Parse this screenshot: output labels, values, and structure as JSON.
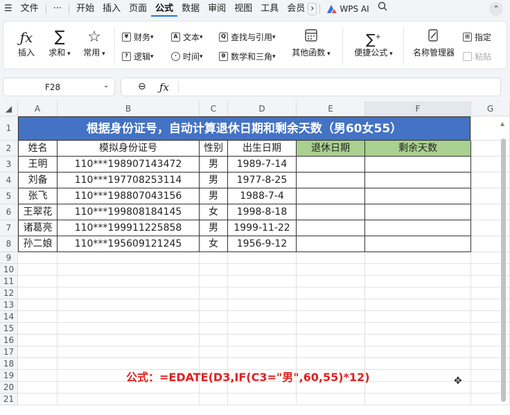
{
  "menu": {
    "items": [
      "文件",
      "开始",
      "插入",
      "页面",
      "公式",
      "数据",
      "审阅",
      "视图",
      "工具",
      "会员"
    ],
    "active": "公式",
    "wps_ai": "WPS AI"
  },
  "ribbon": {
    "insert": "插入",
    "sum": "求和",
    "common": "常用",
    "finance": "财务",
    "text": "文本",
    "lookup": "查找与引用",
    "logic": "逻辑",
    "time": "时间",
    "math": "数学和三角",
    "other": "其他函数",
    "quick": "便捷公式",
    "names": "名称管理器",
    "assign": "指定",
    "paste": "粘贴"
  },
  "namebox": "F28",
  "fx": "fx",
  "columns": [
    "A",
    "B",
    "C",
    "D",
    "E",
    "F",
    "G"
  ],
  "rows": [
    "1",
    "2",
    "3",
    "4",
    "5",
    "6",
    "7",
    "8",
    "9",
    "10",
    "11",
    "12",
    "13",
    "14",
    "15",
    "16",
    "17",
    "18",
    "19",
    "20",
    "21"
  ],
  "title": "根据身份证号，自动计算退休日期和剩余天数（男60女55）",
  "headers": [
    "姓名",
    "模拟身份证号",
    "性别",
    "出生日期",
    "退休日期",
    "剩余天数"
  ],
  "table": [
    [
      "王明",
      "110***198907143472",
      "男",
      "1989-7-14",
      "",
      ""
    ],
    [
      "刘备",
      "110***197708253114",
      "男",
      "1977-8-25",
      "",
      ""
    ],
    [
      "张飞",
      "110***198807043156",
      "男",
      "1988-7-4",
      "",
      ""
    ],
    [
      "王翠花",
      "110***199808184145",
      "女",
      "1998-8-18",
      "",
      ""
    ],
    [
      "诸葛亮",
      "110***199911225858",
      "男",
      "1999-11-22",
      "",
      ""
    ],
    [
      "孙二娘",
      "110***195609121245",
      "女",
      "1956-9-12",
      "",
      ""
    ]
  ],
  "formula_note": "公式：=EDATE(D3,IF(C3=\"男\",60,55)*12)",
  "colors": {
    "title_bg": "#4472c4",
    "green_header": "#a9d08e",
    "formula": "#e02020"
  }
}
